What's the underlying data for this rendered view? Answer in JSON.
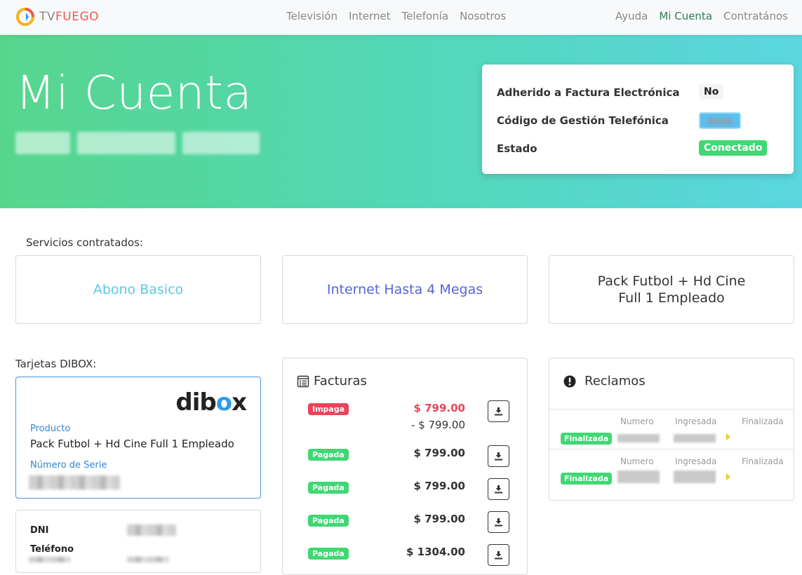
{
  "brand": {
    "tv": "TV",
    "fuego": "FUEGO"
  },
  "nav": {
    "center": [
      "Televisión",
      "Internet",
      "Telefonía",
      "Nosotros"
    ],
    "right": [
      "Ayuda",
      "Mi Cuenta",
      "Contratános"
    ]
  },
  "hero": {
    "title": "Mi Cuenta",
    "info": [
      {
        "label": "Adherido a Factura Electrónica",
        "value": "No"
      },
      {
        "label": "Código de Gestión Telefónica",
        "value": ""
      },
      {
        "label": "Estado",
        "value": "Conectado"
      }
    ]
  },
  "services": {
    "label": "Servicios contratados:",
    "items": [
      "Abono Basico",
      "Internet Hasta 4 Megas",
      "Pack Futbol + Hd Cine Full 1 Empleado"
    ]
  },
  "dibox": {
    "label": "Tarjetas DIBOX:",
    "logo_a": "dib",
    "logo_o": "o",
    "logo_b": "x",
    "producto_label": "Producto",
    "producto": "Pack Futbol + Hd Cine Full 1 Empleado",
    "serie_label": "Número de Serie"
  },
  "person": {
    "dni_label": "DNI",
    "tel_label": "Teléfono"
  },
  "facturas": {
    "title": "Facturas",
    "items": [
      {
        "status": "Impaga",
        "amount": "$ 799.00",
        "sub": "- $ 799.00"
      },
      {
        "status": "Pagada",
        "amount": "$ 799.00"
      },
      {
        "status": "Pagada",
        "amount": "$ 799.00"
      },
      {
        "status": "Pagada",
        "amount": "$ 799.00"
      },
      {
        "status": "Pagada",
        "amount": "$ 1304.00"
      }
    ]
  },
  "reclamos": {
    "title": "Reclamos",
    "columns": [
      "Numero",
      "Ingresada",
      "Finalizada"
    ],
    "items": [
      {
        "status": "Finalizada"
      },
      {
        "status": "Finalizada"
      }
    ]
  },
  "colors": {
    "accent_green": "#3fd873",
    "accent_red": "#e8445a",
    "link_blue": "#2f86d6",
    "nav_active": "#2e7d53"
  }
}
